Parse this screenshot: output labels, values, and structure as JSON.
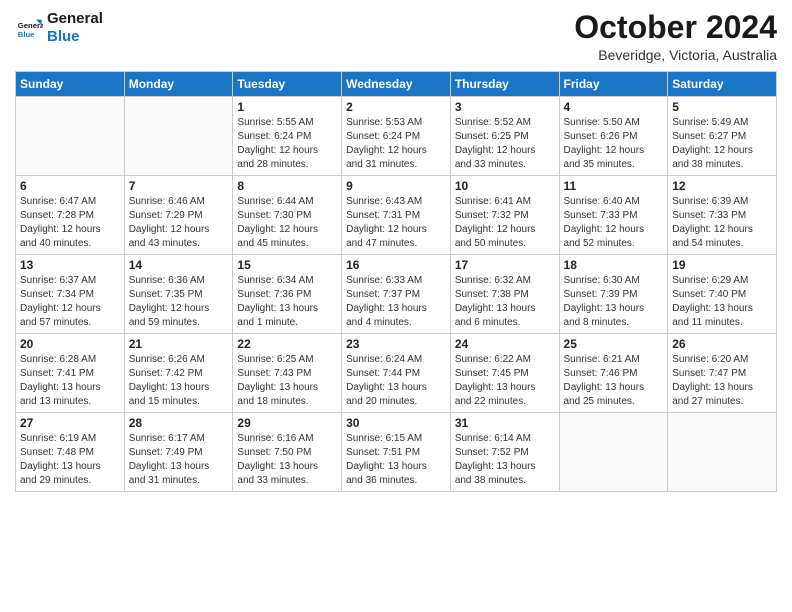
{
  "header": {
    "logo_line1": "General",
    "logo_line2": "Blue",
    "month": "October 2024",
    "location": "Beveridge, Victoria, Australia"
  },
  "weekdays": [
    "Sunday",
    "Monday",
    "Tuesday",
    "Wednesday",
    "Thursday",
    "Friday",
    "Saturday"
  ],
  "weeks": [
    [
      {
        "day": "",
        "info": ""
      },
      {
        "day": "",
        "info": ""
      },
      {
        "day": "1",
        "info": "Sunrise: 5:55 AM\nSunset: 6:24 PM\nDaylight: 12 hours and 28 minutes."
      },
      {
        "day": "2",
        "info": "Sunrise: 5:53 AM\nSunset: 6:24 PM\nDaylight: 12 hours and 31 minutes."
      },
      {
        "day": "3",
        "info": "Sunrise: 5:52 AM\nSunset: 6:25 PM\nDaylight: 12 hours and 33 minutes."
      },
      {
        "day": "4",
        "info": "Sunrise: 5:50 AM\nSunset: 6:26 PM\nDaylight: 12 hours and 35 minutes."
      },
      {
        "day": "5",
        "info": "Sunrise: 5:49 AM\nSunset: 6:27 PM\nDaylight: 12 hours and 38 minutes."
      }
    ],
    [
      {
        "day": "6",
        "info": "Sunrise: 6:47 AM\nSunset: 7:28 PM\nDaylight: 12 hours and 40 minutes."
      },
      {
        "day": "7",
        "info": "Sunrise: 6:46 AM\nSunset: 7:29 PM\nDaylight: 12 hours and 43 minutes."
      },
      {
        "day": "8",
        "info": "Sunrise: 6:44 AM\nSunset: 7:30 PM\nDaylight: 12 hours and 45 minutes."
      },
      {
        "day": "9",
        "info": "Sunrise: 6:43 AM\nSunset: 7:31 PM\nDaylight: 12 hours and 47 minutes."
      },
      {
        "day": "10",
        "info": "Sunrise: 6:41 AM\nSunset: 7:32 PM\nDaylight: 12 hours and 50 minutes."
      },
      {
        "day": "11",
        "info": "Sunrise: 6:40 AM\nSunset: 7:33 PM\nDaylight: 12 hours and 52 minutes."
      },
      {
        "day": "12",
        "info": "Sunrise: 6:39 AM\nSunset: 7:33 PM\nDaylight: 12 hours and 54 minutes."
      }
    ],
    [
      {
        "day": "13",
        "info": "Sunrise: 6:37 AM\nSunset: 7:34 PM\nDaylight: 12 hours and 57 minutes."
      },
      {
        "day": "14",
        "info": "Sunrise: 6:36 AM\nSunset: 7:35 PM\nDaylight: 12 hours and 59 minutes."
      },
      {
        "day": "15",
        "info": "Sunrise: 6:34 AM\nSunset: 7:36 PM\nDaylight: 13 hours and 1 minute."
      },
      {
        "day": "16",
        "info": "Sunrise: 6:33 AM\nSunset: 7:37 PM\nDaylight: 13 hours and 4 minutes."
      },
      {
        "day": "17",
        "info": "Sunrise: 6:32 AM\nSunset: 7:38 PM\nDaylight: 13 hours and 6 minutes."
      },
      {
        "day": "18",
        "info": "Sunrise: 6:30 AM\nSunset: 7:39 PM\nDaylight: 13 hours and 8 minutes."
      },
      {
        "day": "19",
        "info": "Sunrise: 6:29 AM\nSunset: 7:40 PM\nDaylight: 13 hours and 11 minutes."
      }
    ],
    [
      {
        "day": "20",
        "info": "Sunrise: 6:28 AM\nSunset: 7:41 PM\nDaylight: 13 hours and 13 minutes."
      },
      {
        "day": "21",
        "info": "Sunrise: 6:26 AM\nSunset: 7:42 PM\nDaylight: 13 hours and 15 minutes."
      },
      {
        "day": "22",
        "info": "Sunrise: 6:25 AM\nSunset: 7:43 PM\nDaylight: 13 hours and 18 minutes."
      },
      {
        "day": "23",
        "info": "Sunrise: 6:24 AM\nSunset: 7:44 PM\nDaylight: 13 hours and 20 minutes."
      },
      {
        "day": "24",
        "info": "Sunrise: 6:22 AM\nSunset: 7:45 PM\nDaylight: 13 hours and 22 minutes."
      },
      {
        "day": "25",
        "info": "Sunrise: 6:21 AM\nSunset: 7:46 PM\nDaylight: 13 hours and 25 minutes."
      },
      {
        "day": "26",
        "info": "Sunrise: 6:20 AM\nSunset: 7:47 PM\nDaylight: 13 hours and 27 minutes."
      }
    ],
    [
      {
        "day": "27",
        "info": "Sunrise: 6:19 AM\nSunset: 7:48 PM\nDaylight: 13 hours and 29 minutes."
      },
      {
        "day": "28",
        "info": "Sunrise: 6:17 AM\nSunset: 7:49 PM\nDaylight: 13 hours and 31 minutes."
      },
      {
        "day": "29",
        "info": "Sunrise: 6:16 AM\nSunset: 7:50 PM\nDaylight: 13 hours and 33 minutes."
      },
      {
        "day": "30",
        "info": "Sunrise: 6:15 AM\nSunset: 7:51 PM\nDaylight: 13 hours and 36 minutes."
      },
      {
        "day": "31",
        "info": "Sunrise: 6:14 AM\nSunset: 7:52 PM\nDaylight: 13 hours and 38 minutes."
      },
      {
        "day": "",
        "info": ""
      },
      {
        "day": "",
        "info": ""
      }
    ]
  ]
}
